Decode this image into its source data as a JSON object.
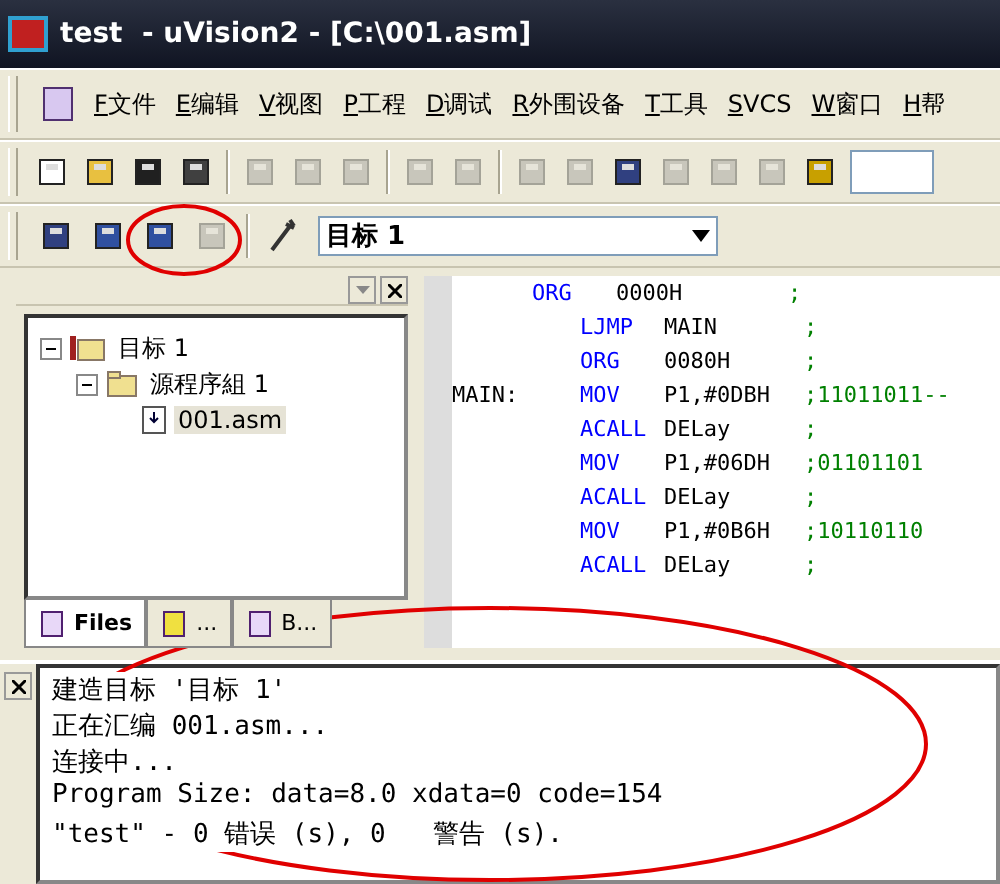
{
  "window": {
    "title": "test  - uVision2 - [C:\\001.asm]"
  },
  "menu": [
    {
      "label": "F文件"
    },
    {
      "label": "E编辑"
    },
    {
      "label": "V视图"
    },
    {
      "label": "P工程"
    },
    {
      "label": "D调试"
    },
    {
      "label": "R外围设备"
    },
    {
      "label": "T工具"
    },
    {
      "label": "SVCS"
    },
    {
      "label": "W窗口"
    },
    {
      "label": "H帮"
    }
  ],
  "toolbar": [
    {
      "kind": "button",
      "disabled": false
    },
    {
      "kind": "button",
      "disabled": false
    },
    {
      "kind": "button",
      "disabled": false
    },
    {
      "kind": "button",
      "disabled": false
    },
    {
      "kind": "separator"
    },
    {
      "kind": "button",
      "disabled": true
    },
    {
      "kind": "button",
      "disabled": true
    },
    {
      "kind": "button",
      "disabled": true
    },
    {
      "kind": "separator"
    },
    {
      "kind": "button",
      "disabled": true
    },
    {
      "kind": "button",
      "disabled": true
    },
    {
      "kind": "separator"
    },
    {
      "kind": "button",
      "disabled": true
    },
    {
      "kind": "button",
      "disabled": true
    },
    {
      "kind": "button",
      "disabled": false
    },
    {
      "kind": "button",
      "disabled": true
    },
    {
      "kind": "button",
      "disabled": true
    },
    {
      "kind": "button",
      "disabled": true
    },
    {
      "kind": "button",
      "disabled": false
    }
  ],
  "build_toolbar": {
    "buttons": [
      {
        "disabled": false
      },
      {
        "disabled": false
      },
      {
        "disabled": false
      },
      {
        "disabled": true
      }
    ],
    "target": "目标 1"
  },
  "project": {
    "tree": [
      {
        "label": "目标 1",
        "kind": "target",
        "expanded": true,
        "selected": false,
        "children": [
          {
            "label": "源程序組 1",
            "kind": "group",
            "expanded": true,
            "selected": false,
            "children": [
              {
                "label": "001.asm",
                "kind": "file",
                "selected": true
              }
            ]
          }
        ]
      }
    ],
    "tabs": [
      {
        "label": "Files",
        "selected": true
      },
      {
        "label": "...",
        "selected": false
      },
      {
        "label": "B...",
        "selected": false
      }
    ]
  },
  "editor": {
    "lines": [
      {
        "op": "ORG",
        "args": "0000H",
        "comment": ";"
      },
      {
        "op": "LJMP",
        "args": "MAIN",
        "comment": ";"
      },
      {
        "op": "ORG",
        "args": "0080H",
        "comment": ";"
      },
      {
        "label": "MAIN:",
        "op": "MOV",
        "args": "P1,#0DBH",
        "comment": ";11011011--"
      },
      {
        "op": "ACALL",
        "args": "DELay",
        "comment": ";"
      },
      {
        "op": "MOV",
        "args": "P1,#06DH",
        "comment": ";01101101"
      },
      {
        "op": "ACALL",
        "args": "DELay",
        "comment": ";"
      },
      {
        "op": "MOV",
        "args": "P1,#0B6H",
        "comment": ";10110110"
      },
      {
        "op": "ACALL",
        "args": "DELay",
        "comment": ";"
      }
    ]
  },
  "output": {
    "lines": [
      "建造目标 '目标 1'",
      "正在汇编 001.asm...",
      "连接中...",
      "Program Size: data=8.0 xdata=0 code=154",
      "\"test\" - 0 错误 (s), 0   警告 (s)."
    ]
  }
}
